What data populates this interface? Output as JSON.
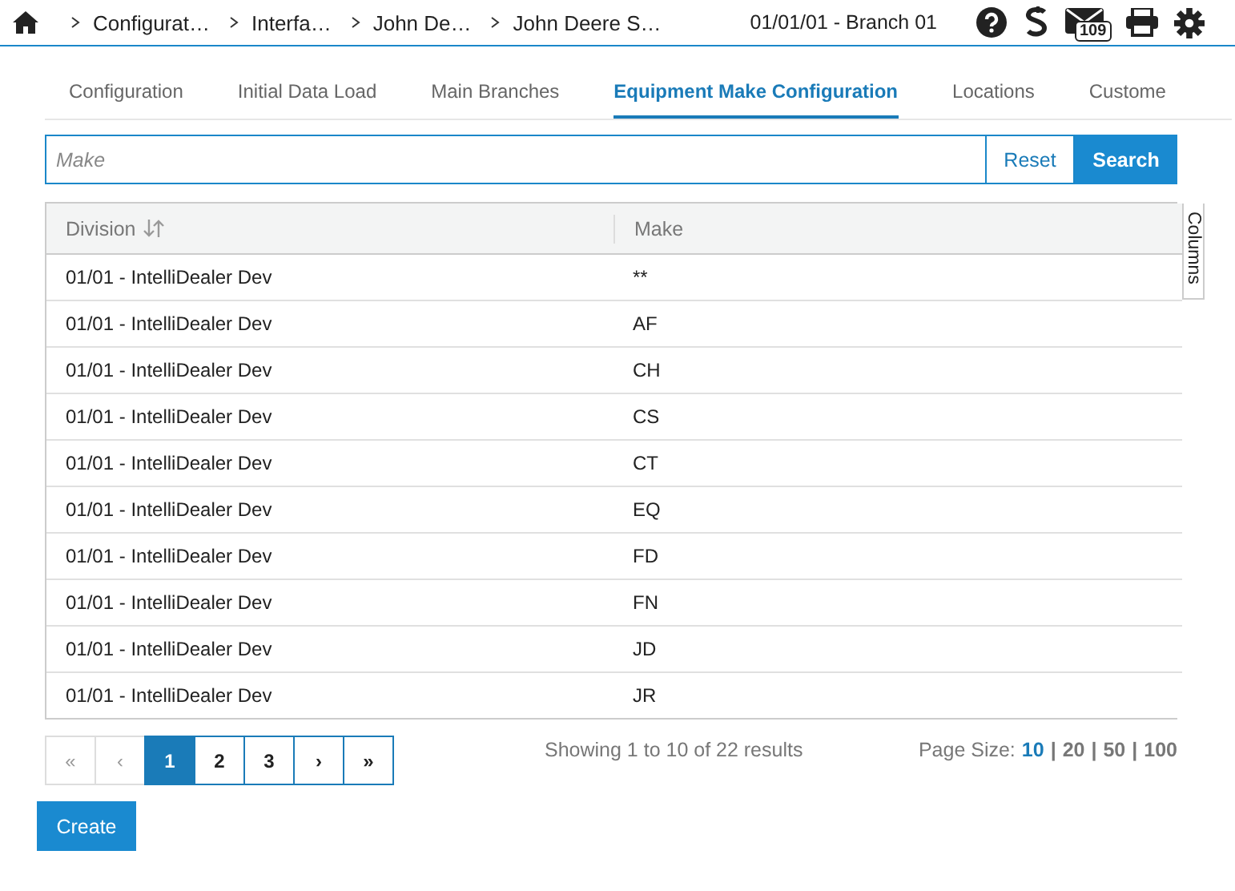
{
  "breadcrumbs": [
    "Configurat…",
    "Interfa…",
    "John De…",
    "John Deere S…"
  ],
  "branch": "01/01/01 - Branch 01",
  "notification_count": "109",
  "tabs": [
    {
      "label": "Configuration",
      "selected": false
    },
    {
      "label": "Initial Data Load",
      "selected": false
    },
    {
      "label": "Main Branches",
      "selected": false
    },
    {
      "label": "Equipment Make Configuration",
      "selected": true
    },
    {
      "label": "Locations",
      "selected": false
    },
    {
      "label": "Custome",
      "selected": false
    }
  ],
  "search": {
    "placeholder": "Make",
    "buttons": [
      "Reset",
      "Search"
    ]
  },
  "table": {
    "columns": [
      {
        "label": "Division",
        "sortable": true
      },
      {
        "label": "Make",
        "sortable": false
      }
    ],
    "columns_toggle": "Columns",
    "rows": [
      [
        "01/01 - IntelliDealer Dev",
        "**"
      ],
      [
        "01/01 - IntelliDealer Dev",
        "AF"
      ],
      [
        "01/01 - IntelliDealer Dev",
        "CH"
      ],
      [
        "01/01 - IntelliDealer Dev",
        "CS"
      ],
      [
        "01/01 - IntelliDealer Dev",
        "CT"
      ],
      [
        "01/01 - IntelliDealer Dev",
        "EQ"
      ],
      [
        "01/01 - IntelliDealer Dev",
        "FD"
      ],
      [
        "01/01 - IntelliDealer Dev",
        "FN"
      ],
      [
        "01/01 - IntelliDealer Dev",
        "JD"
      ],
      [
        "01/01 - IntelliDealer Dev",
        "JR"
      ]
    ]
  },
  "pagination": [
    {
      "label": "«",
      "selected": false,
      "disabled": true
    },
    {
      "label": "‹",
      "selected": false,
      "disabled": true
    },
    {
      "label": "1",
      "selected": true,
      "disabled": false
    },
    {
      "label": "2",
      "selected": false,
      "disabled": false
    },
    {
      "label": "3",
      "selected": false,
      "disabled": false
    },
    {
      "label": "›",
      "selected": false,
      "disabled": false
    },
    {
      "label": "»",
      "selected": false,
      "disabled": false
    }
  ],
  "summary": "Showing 1 to 10 of 22 results",
  "page_size": {
    "label": "Page Size:",
    "separator": "|",
    "options": [
      {
        "label": "10",
        "selected": true
      },
      {
        "label": "20",
        "selected": false
      },
      {
        "label": "50",
        "selected": false
      },
      {
        "label": "100",
        "selected": false
      }
    ]
  },
  "create_button": "Create"
}
